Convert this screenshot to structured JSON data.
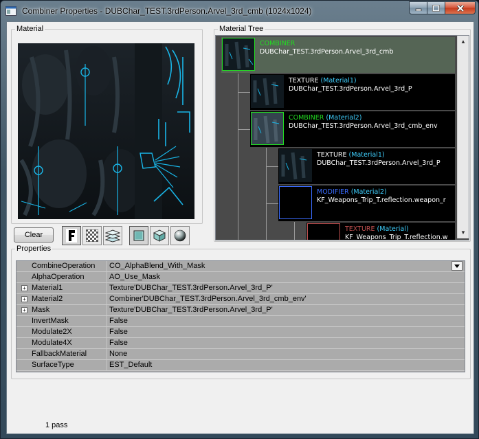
{
  "window": {
    "title": "Combiner Properties - DUBChar_TEST.3rdPerson.Arvel_3rd_cmb (1024x1024)"
  },
  "material_group": {
    "label": "Material"
  },
  "toolbar": {
    "clear_label": "Clear"
  },
  "tree_group": {
    "label": "Material Tree"
  },
  "tree": {
    "nodes": [
      {
        "type": "COMBINER",
        "slot": "",
        "name": "DUBChar_TEST.3rdPerson.Arvel_3rd_cmb"
      },
      {
        "type": "TEXTURE",
        "slot": "(Material1)",
        "name": "DUBChar_TEST.3rdPerson.Arvel_3rd_P"
      },
      {
        "type": "COMBINER",
        "slot": "(Material2)",
        "name": "DUBChar_TEST.3rdPerson.Arvel_3rd_cmb_env"
      },
      {
        "type": "TEXTURE",
        "slot": "(Material1)",
        "name": "DUBChar_TEST.3rdPerson.Arvel_3rd_P"
      },
      {
        "type": "MODIFIER",
        "slot": "(Material2)",
        "name": "KF_Weapons_Trip_T.reflection.weapon_r"
      },
      {
        "type": "TEXTURE",
        "slot": "(Material)",
        "name": "KF_Weapons_Trip_T.reflection.w"
      }
    ]
  },
  "properties_group": {
    "label": "Properties"
  },
  "properties": [
    {
      "name": "CombineOperation",
      "value": "CO_AlphaBlend_With_Mask",
      "expandable": false,
      "dropdown": true
    },
    {
      "name": "AlphaOperation",
      "value": "AO_Use_Mask",
      "expandable": false,
      "dropdown": false
    },
    {
      "name": "Material1",
      "value": "Texture'DUBChar_TEST.3rdPerson.Arvel_3rd_P'",
      "expandable": true,
      "dropdown": false
    },
    {
      "name": "Material2",
      "value": "Combiner'DUBChar_TEST.3rdPerson.Arvel_3rd_cmb_env'",
      "expandable": true,
      "dropdown": false
    },
    {
      "name": "Mask",
      "value": "Texture'DUBChar_TEST.3rdPerson.Arvel_3rd_P'",
      "expandable": true,
      "dropdown": false
    },
    {
      "name": "InvertMask",
      "value": "False",
      "expandable": false,
      "dropdown": false
    },
    {
      "name": "Modulate2X",
      "value": "False",
      "expandable": false,
      "dropdown": false
    },
    {
      "name": "Modulate4X",
      "value": "False",
      "expandable": false,
      "dropdown": false
    },
    {
      "name": "FallbackMaterial",
      "value": "None",
      "expandable": false,
      "dropdown": false
    },
    {
      "name": "SurfaceType",
      "value": "EST_Default",
      "expandable": false,
      "dropdown": false
    }
  ],
  "status": {
    "text": "1 pass"
  },
  "colors": {
    "combiner": "#22dd22",
    "texture": "#ffffff",
    "modifier": "#3a6cff",
    "texture_dim": "#c05050",
    "slot": "#3fd0ff",
    "accent_cyan": "#19b6e8"
  },
  "icons": {
    "toolbar": [
      "font-icon",
      "checker-icon",
      "layers-icon",
      "plane-icon",
      "cube-icon",
      "sphere-icon"
    ],
    "caption": [
      "minimize-icon",
      "maximize-icon",
      "close-icon"
    ]
  }
}
